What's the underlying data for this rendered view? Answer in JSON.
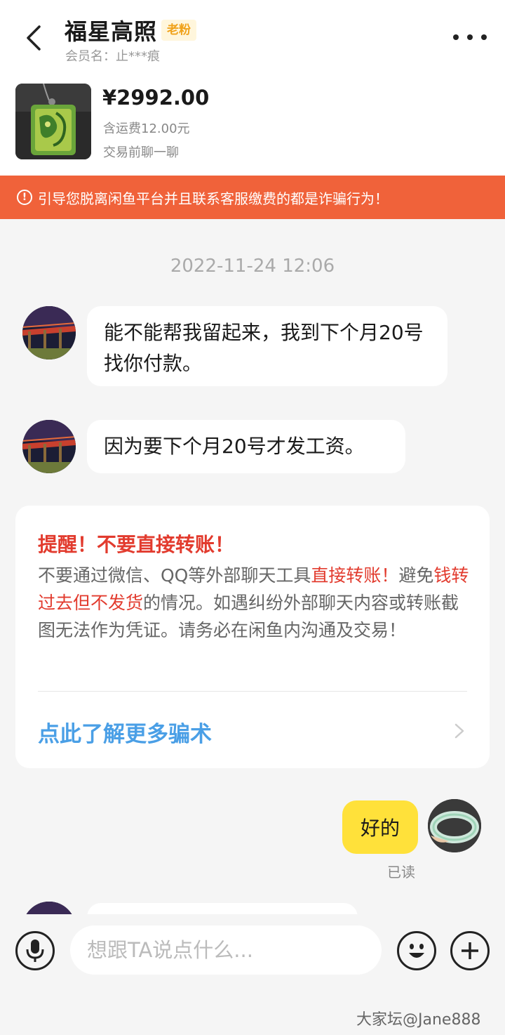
{
  "header": {
    "back_icon": "chevron-left-icon",
    "title": "福星高照",
    "badge": "老粉",
    "member": "会员名：止***痕",
    "more_icon": "ellipsis-icon"
  },
  "product": {
    "price": "¥2992.00",
    "shipping": "含运费12.00元",
    "pre_trade": "交易前聊一聊"
  },
  "warning_banner": {
    "icon": "alert-circle-icon",
    "text": "引导您脱离闲鱼平台并且联系客服缴费的都是诈骗行为！"
  },
  "chat": {
    "timestamp": "2022-11-24 12:06",
    "messages": [
      {
        "from": "other",
        "text": "能不能帮我留起来，我到下个月20号找你付款。"
      },
      {
        "from": "other",
        "text": "因为要下个月20号才发工资。"
      },
      {
        "from": "self",
        "text": "好的",
        "status": "已读"
      }
    ]
  },
  "fraud_card": {
    "title": "提醒！不要直接转账！",
    "body_1": "不要通过微信、QQ等外部聊天工具",
    "body_red_1": "直接转账！",
    "body_2": "避免",
    "body_red_2": "钱转过去但不发货",
    "body_3": "的情况。如遇纠纷外部聊天内容或转账截图无法作为凭证。请务必在闲鱼内沟通及交易！",
    "link": "点此了解更多骗术",
    "link_icon": "chevron-right-icon"
  },
  "input_bar": {
    "mic_icon": "microphone-icon",
    "placeholder": "想跟TA说点什么...",
    "emoji_icon": "smiley-icon",
    "plus_icon": "plus-icon"
  },
  "watermark": "大家坛@Jane888",
  "colors": {
    "banner": "#f0623a",
    "self_bubble": "#ffe13a",
    "warning_red": "#e23b2e",
    "link_blue": "#4a9fe6",
    "badge_orange": "#f0a21a"
  }
}
